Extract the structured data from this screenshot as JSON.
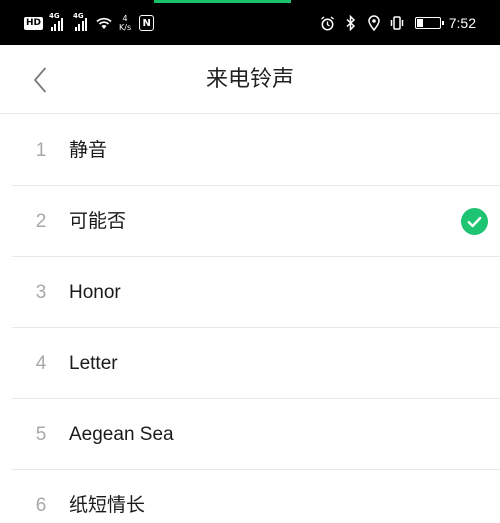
{
  "status_bar": {
    "hd": "HD",
    "sim1_type": "4G",
    "sim2_type": "4G",
    "speed_value": "4",
    "speed_unit": "K/s",
    "nfc": "N",
    "time": "7:52",
    "icons": [
      "alarm-icon",
      "bluetooth-icon",
      "location-icon",
      "vibrate-icon",
      "battery-icon"
    ],
    "accent_color": "#18c26a"
  },
  "header": {
    "title": "来电铃声"
  },
  "ringtones": [
    {
      "index": "1",
      "name": "静音",
      "selected": false
    },
    {
      "index": "2",
      "name": "可能否",
      "selected": true
    },
    {
      "index": "3",
      "name": "Honor",
      "selected": false
    },
    {
      "index": "4",
      "name": "Letter",
      "selected": false
    },
    {
      "index": "5",
      "name": "Aegean Sea",
      "selected": false
    },
    {
      "index": "6",
      "name": "纸短情长",
      "selected": false
    }
  ],
  "colors": {
    "check": "#1fc473",
    "index_text": "#a8a8a8",
    "name_text": "#1a1a1a"
  }
}
